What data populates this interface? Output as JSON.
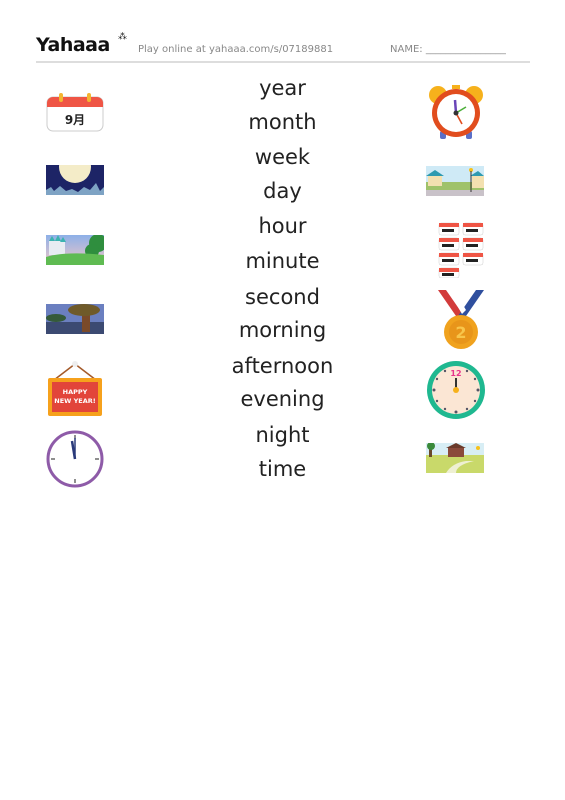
{
  "header": {
    "logo": "Yahaaa",
    "play_online": "Play online at yahaaa.com/s/07189881",
    "name_label": "NAME: ________________"
  },
  "words": [
    "year",
    "month",
    "week",
    "day",
    "hour",
    "minute",
    "second",
    "morning",
    "afternoon",
    "evening",
    "night",
    "time"
  ],
  "left_images": [
    {
      "icon": "calendar-icon",
      "label": "9月"
    },
    {
      "icon": "full-moon-night-icon"
    },
    {
      "icon": "castle-morning-scene-icon"
    },
    {
      "icon": "tree-evening-scene-icon"
    },
    {
      "icon": "happy-new-year-sign-icon",
      "label": "HAPPY NEW YEAR!"
    },
    {
      "icon": "wall-clock-midnight-icon"
    }
  ],
  "right_images": [
    {
      "icon": "alarm-clock-icon"
    },
    {
      "icon": "street-daytime-scene-icon"
    },
    {
      "icon": "weekly-calendar-icon"
    },
    {
      "icon": "second-place-medal-icon",
      "label": "2"
    },
    {
      "icon": "noon-clock-icon",
      "label": "12"
    },
    {
      "icon": "house-afternoon-scene-icon"
    }
  ]
}
